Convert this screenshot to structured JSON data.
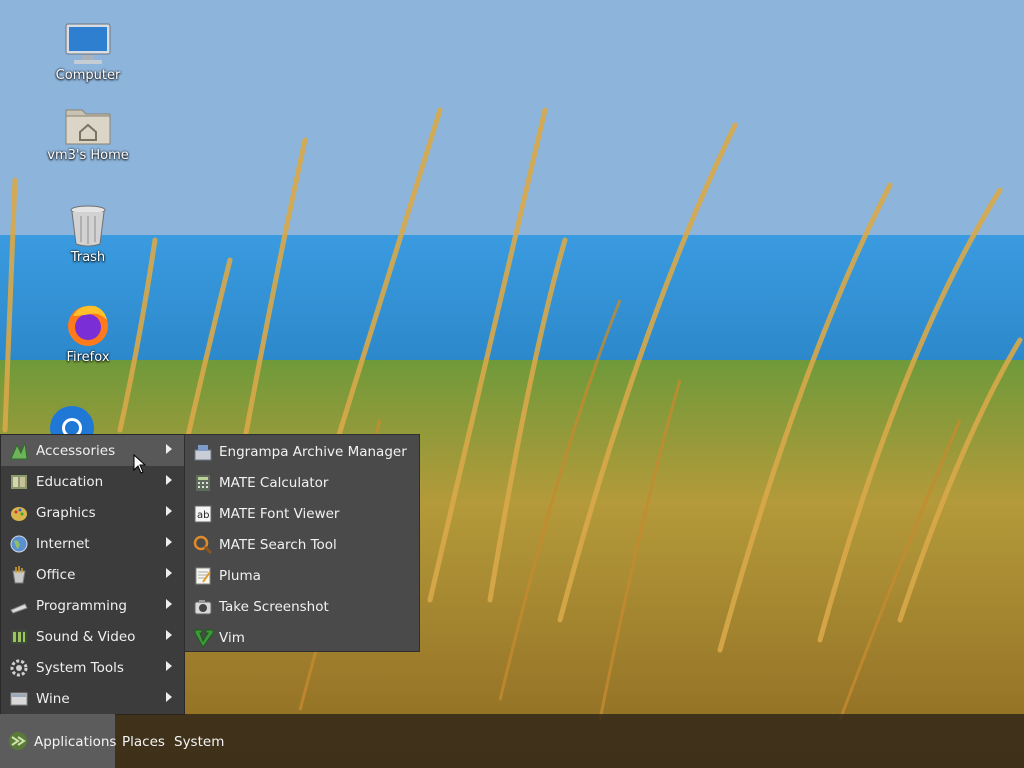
{
  "desktop": {
    "icons": [
      {
        "label": "Computer",
        "icon": "computer-icon"
      },
      {
        "label": "vm3's Home",
        "icon": "home-folder-icon"
      },
      {
        "label": "Trash",
        "icon": "trash-icon"
      },
      {
        "label": "Firefox",
        "icon": "firefox-icon"
      },
      {
        "label": "",
        "icon": "chromium-icon"
      }
    ]
  },
  "menu": {
    "items": [
      {
        "label": "Accessories",
        "icon": "accessories-icon",
        "active": true
      },
      {
        "label": "Education",
        "icon": "education-icon"
      },
      {
        "label": "Graphics",
        "icon": "graphics-icon"
      },
      {
        "label": "Internet",
        "icon": "internet-icon"
      },
      {
        "label": "Office",
        "icon": "office-icon"
      },
      {
        "label": "Programming",
        "icon": "programming-icon"
      },
      {
        "label": "Sound & Video",
        "icon": "sound-video-icon"
      },
      {
        "label": "System Tools",
        "icon": "system-tools-icon"
      },
      {
        "label": "Wine",
        "icon": "wine-icon"
      }
    ]
  },
  "submenu": {
    "items": [
      {
        "label": "Engrampa Archive Manager",
        "icon": "archive-manager-icon"
      },
      {
        "label": "MATE Calculator",
        "icon": "calculator-icon"
      },
      {
        "label": "MATE Font Viewer",
        "icon": "font-viewer-icon"
      },
      {
        "label": "MATE Search Tool",
        "icon": "search-tool-icon"
      },
      {
        "label": "Pluma",
        "icon": "text-editor-icon"
      },
      {
        "label": "Take Screenshot",
        "icon": "screenshot-icon"
      },
      {
        "label": "Vim",
        "icon": "vim-icon"
      }
    ]
  },
  "panel": {
    "applications": "Applications",
    "places": "Places",
    "system": "System"
  },
  "colors": {
    "menu_bg": "#3c3c3c",
    "submenu_bg": "#4a4a4a",
    "active_item": "#585858",
    "panel_bg": "#2d2319"
  }
}
